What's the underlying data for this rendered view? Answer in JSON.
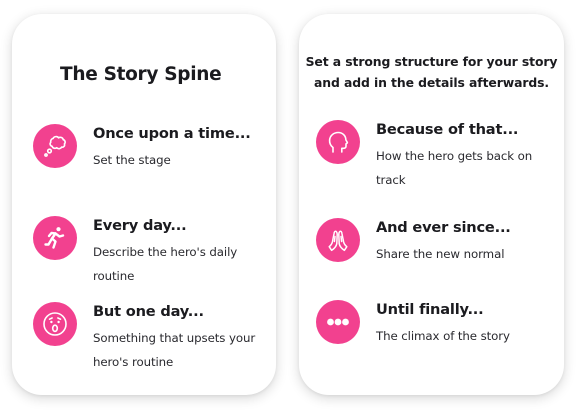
{
  "left_card": {
    "title": "The Story Spine",
    "items": [
      {
        "heading": "Once upon a time...",
        "description": "Set the stage",
        "icon": "thought-bubble-icon"
      },
      {
        "heading": "Every day...",
        "description": "Describe the hero's daily routine",
        "icon": "running-person-icon"
      },
      {
        "heading": "But one day...",
        "description": "Something that upsets your hero's routine",
        "icon": "surprised-face-icon"
      }
    ]
  },
  "right_card": {
    "intro": "Set a strong structure for your story and add in the details afterwards.",
    "items": [
      {
        "heading": "Because of that...",
        "description": "How the hero gets back on track",
        "icon": "head-profile-icon"
      },
      {
        "heading": "And ever since...",
        "description": "Share the new normal",
        "icon": "praying-hands-icon"
      },
      {
        "heading": "Until finally...",
        "description": "The climax of the story",
        "icon": "ellipsis-icon"
      }
    ]
  },
  "colors": {
    "accent": "#f2418f",
    "text": "#1b1b1f",
    "card_background": "#ffffff"
  }
}
